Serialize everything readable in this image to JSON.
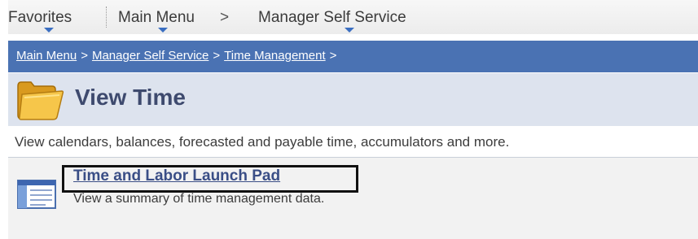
{
  "menu": {
    "favorites": "Favorites",
    "main_menu": "Main Menu",
    "separator": ">",
    "manager_self_service": "Manager Self Service"
  },
  "breadcrumb": {
    "items": [
      "Main Menu",
      "Manager Self Service",
      "Time Management"
    ],
    "separator": ">"
  },
  "page": {
    "title": "View Time",
    "description": "View calendars, balances, forecasted and payable time, accumulators and more."
  },
  "links": [
    {
      "title": "Time and Labor Launch Pad",
      "description": "View a summary of time management data."
    }
  ],
  "colors": {
    "breadcrumb_bar": "#4a72b3",
    "title_band": "#dde3ee",
    "link": "#3a4e86",
    "highlight": "#111111"
  },
  "icons": {
    "caret": "chevron-down-icon",
    "folder": "folder-icon",
    "link": "window-icon"
  }
}
